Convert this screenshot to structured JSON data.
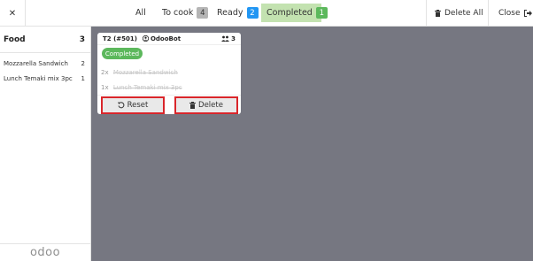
{
  "topbar": {
    "close_icon": "close-icon",
    "tabs": [
      {
        "label": "All",
        "count": ""
      },
      {
        "label": "To cook",
        "count": "4"
      },
      {
        "label": "Ready",
        "count": "2"
      },
      {
        "label": "Completed",
        "count": "1"
      }
    ],
    "delete_all_label": "Delete All",
    "close_label": "Close",
    "colors": {
      "ready_badge": "#2196f3",
      "completed_badge": "#5cb85c",
      "completed_tab_bg": "#c3e2b0"
    }
  },
  "sidebar": {
    "category": {
      "name": "Food",
      "count": "3"
    },
    "items": [
      {
        "name": "Mozzarella Sandwich",
        "count": "2"
      },
      {
        "name": "Lunch Temaki mix 3pc",
        "count": "1"
      }
    ],
    "logo": "odoo"
  },
  "order": {
    "table": "T2 (#501)",
    "employee": "OdooBot",
    "guests": "3",
    "status": "Completed",
    "lines": [
      {
        "qty": "2x",
        "name": "Mozzarella Sandwich"
      },
      {
        "qty": "1x",
        "name": "Lunch Temaki mix 3pc"
      }
    ],
    "reset_label": "Reset",
    "delete_label": "Delete"
  }
}
